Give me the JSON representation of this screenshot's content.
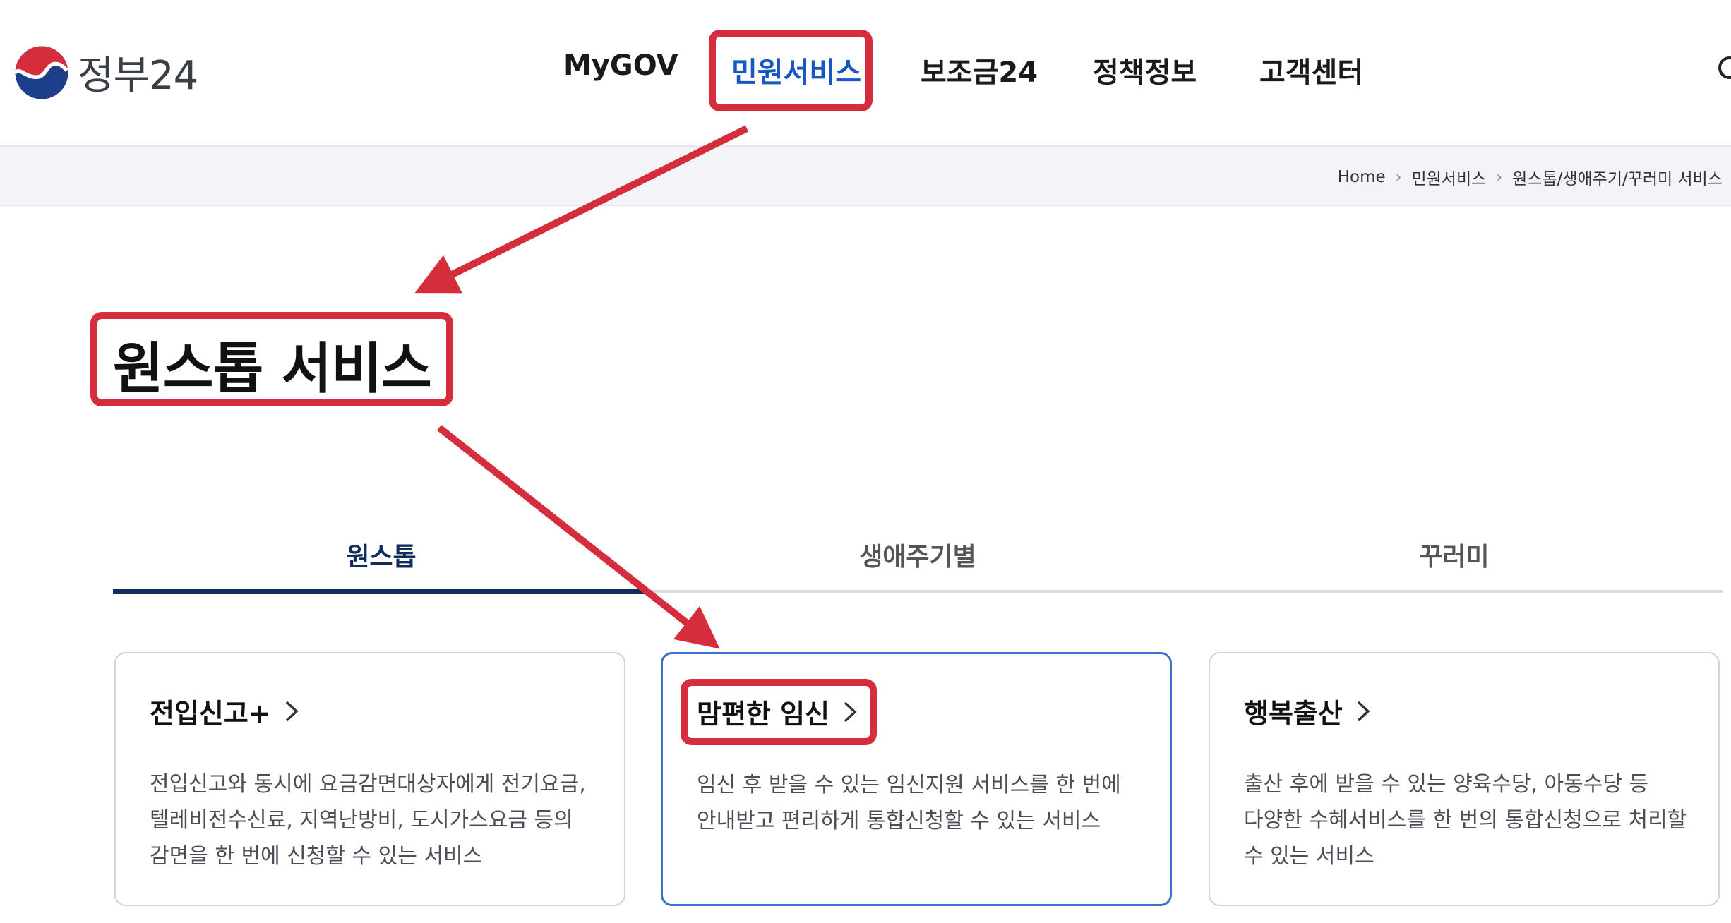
{
  "header": {
    "logo_text": "정부24",
    "nav": [
      {
        "label": "MyGOV"
      },
      {
        "label": "민원서비스"
      },
      {
        "label": "보조금24"
      },
      {
        "label": "정책정보"
      },
      {
        "label": "고객센터"
      }
    ],
    "search_icon": "search-icon"
  },
  "breadcrumb": [
    "Home",
    "민원서비스",
    "원스톱/생애주기/꾸러미 서비스"
  ],
  "page_title": "원스톱 서비스",
  "tabs": [
    {
      "label": "원스톱",
      "active": true
    },
    {
      "label": "생애주기별",
      "active": false
    },
    {
      "label": "꾸러미",
      "active": false
    }
  ],
  "cards": [
    {
      "title": "전입신고+",
      "desc": "전입신고와 동시에 요금감면대상자에게 전기요금, 텔레비전수신료, 지역난방비, 도시가스요금 등의 감면을 한 번에 신청할 수 있는 서비스"
    },
    {
      "title": "맘편한 임신",
      "desc": "임신 후 받을 수 있는 임신지원 서비스를 한 번에 안내받고 편리하게 통합신청할 수 있는 서비스"
    },
    {
      "title": "행복출산",
      "desc": "출산 후에 받을 수 있는 양육수당, 아동수당 등 다양한 수혜서비스를 한 번의 통합신청으로 처리할 수 있는 서비스"
    }
  ],
  "colors": {
    "accent_blue": "#1558c0",
    "tab_navy": "#112d5c",
    "card_active_border": "#3d6fd1",
    "annotation_red": "#d62d3c"
  }
}
